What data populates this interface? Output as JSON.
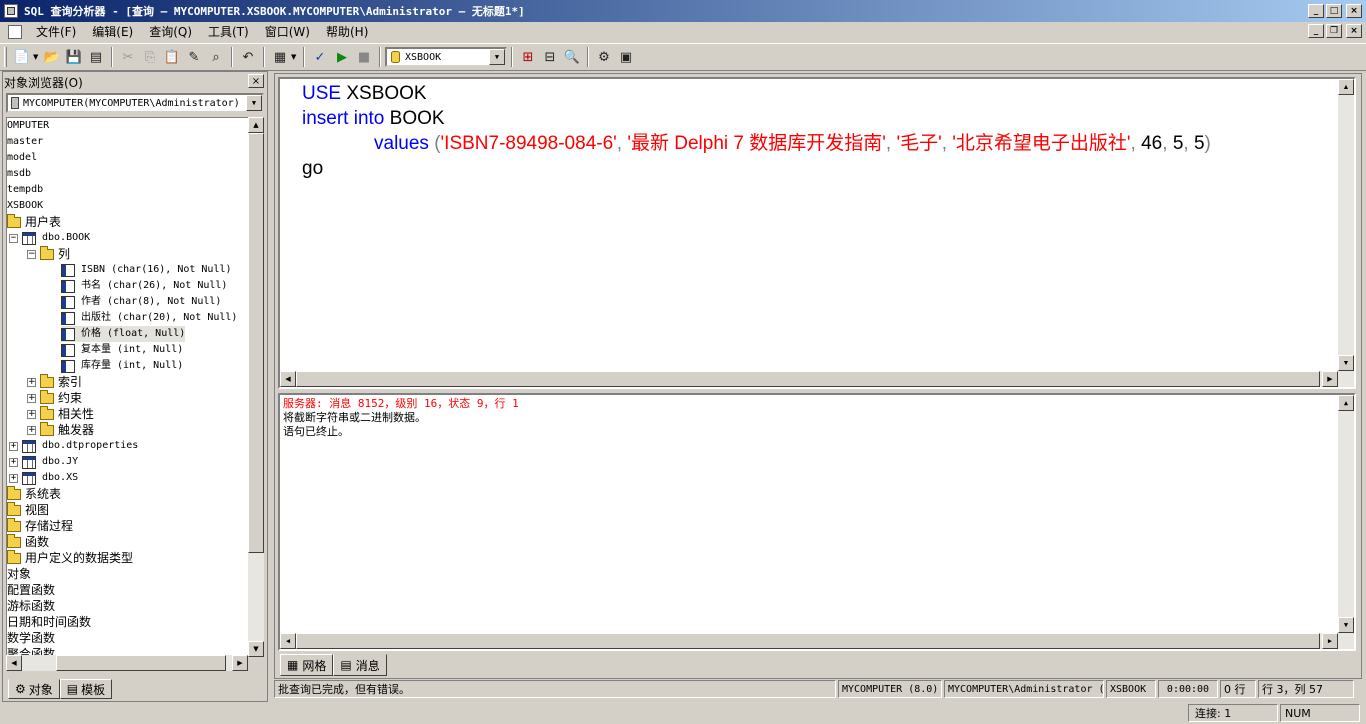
{
  "window": {
    "title": "SQL 查询分析器 - [查询 — MYCOMPUTER.XSBOOK.MYCOMPUTER\\Administrator — 无标题1*]"
  },
  "menu": [
    {
      "label": "文件(F)"
    },
    {
      "label": "编辑(E)"
    },
    {
      "label": "查询(Q)"
    },
    {
      "label": "工具(T)"
    },
    {
      "label": "窗口(W)"
    },
    {
      "label": "帮助(H)"
    }
  ],
  "toolbar": {
    "database": "XSBOOK"
  },
  "object_browser": {
    "title": "对象浏览器(O)",
    "server": "MYCOMPUTER(MYCOMPUTER\\Administrator)",
    "tree": [
      {
        "label": "OMPUTER",
        "mono": true
      },
      {
        "label": "master",
        "mono": true
      },
      {
        "label": "model",
        "mono": true
      },
      {
        "label": "msdb",
        "mono": true
      },
      {
        "label": "tempdb",
        "mono": true
      },
      {
        "label": "XSBOOK",
        "mono": true
      },
      {
        "label": "用户表"
      },
      {
        "label": "dbo.BOOK",
        "mono": true
      },
      {
        "label": "列"
      },
      {
        "label": "ISBN (char(16), Not Null)",
        "mono": true
      },
      {
        "label": "书名 (char(26), Not Null)",
        "mono": true
      },
      {
        "label": "作者 (char(8), Not Null)",
        "mono": true
      },
      {
        "label": "出版社 (char(20), Not Null)",
        "mono": true
      },
      {
        "label": "价格 (float, Null)",
        "mono": true
      },
      {
        "label": "复本量 (int, Null)",
        "mono": true
      },
      {
        "label": "库存量 (int, Null)",
        "mono": true
      },
      {
        "label": "索引"
      },
      {
        "label": "约束"
      },
      {
        "label": "相关性"
      },
      {
        "label": "触发器"
      },
      {
        "label": "dbo.dtproperties",
        "mono": true
      },
      {
        "label": "dbo.JY",
        "mono": true
      },
      {
        "label": "dbo.XS",
        "mono": true
      },
      {
        "label": "系统表"
      },
      {
        "label": "视图"
      },
      {
        "label": "存储过程"
      },
      {
        "label": "函数"
      },
      {
        "label": "用户定义的数据类型"
      },
      {
        "label": "对象"
      },
      {
        "label": "配置函数"
      },
      {
        "label": "游标函数"
      },
      {
        "label": "日期和时间函数"
      },
      {
        "label": "数学函数"
      },
      {
        "label": "聚合函数"
      }
    ],
    "tabs": [
      {
        "label": "对象"
      },
      {
        "label": "模板"
      }
    ]
  },
  "editor": {
    "line1_kw": "USE",
    "line1_rest": " XSBOOK",
    "line2_kw": "insert into",
    "line2_rest": " BOOK",
    "line3_kw": "values",
    "line3_s1": "'ISBN7-89498-084-6'",
    "line3_s2": "'最新 Delphi 7 数据库开发指南'",
    "line3_s3": "'毛子'",
    "line3_s4": "'北京希望电子出版社'",
    "line3_n1": "46",
    "line3_n2": "5",
    "line3_n3": "5",
    "line4": "go"
  },
  "messages": {
    "line1": "服务器: 消息 8152，级别 16，状态 9，行 1",
    "line2": "将截断字符串或二进制数据。",
    "line3": "语句已终止。"
  },
  "result_tabs": [
    {
      "label": "网格"
    },
    {
      "label": "消息"
    }
  ],
  "status": {
    "message": "批查询已完成，但有错误。",
    "server": "MYCOMPUTER (8.0)",
    "user": "MYCOMPUTER\\Administrator (",
    "database": "XSBOOK",
    "time": "0:00:00",
    "rows": "0 行",
    "position": "行 3，列 57"
  },
  "bottom": {
    "connections": "连接: 1",
    "num": "NUM"
  },
  "colors": {
    "keyword": "#0000ff",
    "string": "#ff0000",
    "error": "#ff0000",
    "title_start": "#0a246a",
    "title_end": "#a6caf0"
  }
}
